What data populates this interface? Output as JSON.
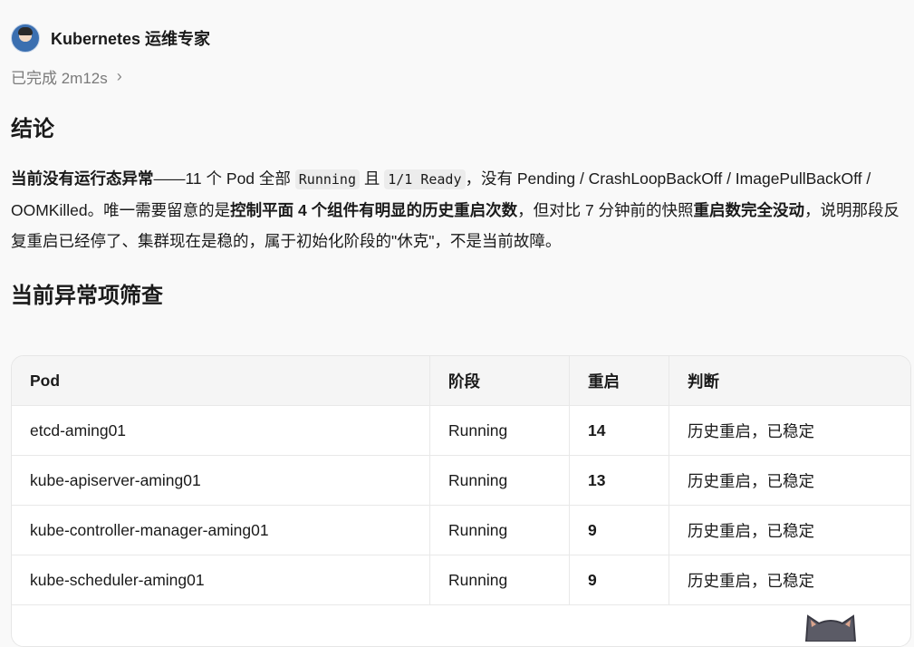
{
  "agent": {
    "name": "Kubernetes 运维专家"
  },
  "status": {
    "text": "已完成 2m12s"
  },
  "sections": {
    "conclusion_title": "结论",
    "check_title": "当前异常项筛查"
  },
  "paragraph": {
    "p1_bold": "当前没有运行态异常",
    "p2": "——11 个 Pod 全部 ",
    "p3_code": "Running",
    "p4": " 且 ",
    "p5_code": "1/1 Ready",
    "p6": "，没有 Pending / CrashLoopBackOff / ImagePullBackOff / OOMKilled。唯一需要留意的是",
    "p7_bold": "控制平面 4 个组件有明显的历史重启次数",
    "p8": "，但对比 7 分钟前的快照",
    "p9_bold": "重启数完全没动",
    "p10": "，说明那段反复重启已经停了、集群现在是稳的，属于初始化阶段的\"休克\"，不是当前故障。"
  },
  "table": {
    "headers": [
      "Pod",
      "阶段",
      "重启",
      "判断"
    ],
    "rows": [
      {
        "pod": "etcd-aming01",
        "phase": "Running",
        "restarts": "14",
        "verdict": "历史重启，已稳定"
      },
      {
        "pod": "kube-apiserver-aming01",
        "phase": "Running",
        "restarts": "13",
        "verdict": "历史重启，已稳定"
      },
      {
        "pod": "kube-controller-manager-aming01",
        "phase": "Running",
        "restarts": "9",
        "verdict": "历史重启，已稳定"
      },
      {
        "pod": "kube-scheduler-aming01",
        "phase": "Running",
        "restarts": "9",
        "verdict": "历史重启，已稳定"
      }
    ]
  },
  "icons": {
    "avatar": "user-avatar",
    "chevron": "chevron-right-icon",
    "mascot": "cat-mascot"
  }
}
